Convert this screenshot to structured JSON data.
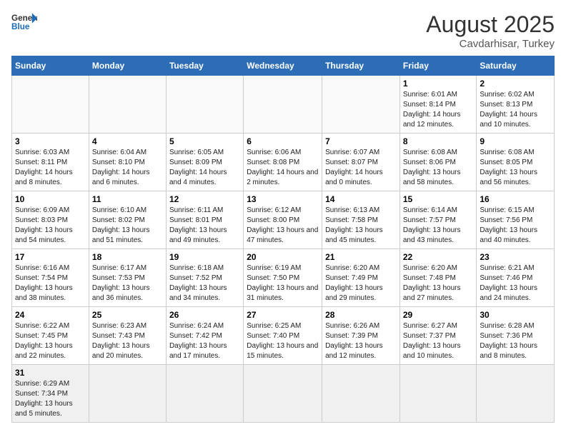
{
  "header": {
    "logo_general": "General",
    "logo_blue": "Blue",
    "month_year": "August 2025",
    "location": "Cavdarhisar, Turkey"
  },
  "days_of_week": [
    "Sunday",
    "Monday",
    "Tuesday",
    "Wednesday",
    "Thursday",
    "Friday",
    "Saturday"
  ],
  "weeks": [
    [
      {
        "day": "",
        "info": ""
      },
      {
        "day": "",
        "info": ""
      },
      {
        "day": "",
        "info": ""
      },
      {
        "day": "",
        "info": ""
      },
      {
        "day": "",
        "info": ""
      },
      {
        "day": "1",
        "info": "Sunrise: 6:01 AM\nSunset: 8:14 PM\nDaylight: 14 hours and 12 minutes."
      },
      {
        "day": "2",
        "info": "Sunrise: 6:02 AM\nSunset: 8:13 PM\nDaylight: 14 hours and 10 minutes."
      }
    ],
    [
      {
        "day": "3",
        "info": "Sunrise: 6:03 AM\nSunset: 8:11 PM\nDaylight: 14 hours and 8 minutes."
      },
      {
        "day": "4",
        "info": "Sunrise: 6:04 AM\nSunset: 8:10 PM\nDaylight: 14 hours and 6 minutes."
      },
      {
        "day": "5",
        "info": "Sunrise: 6:05 AM\nSunset: 8:09 PM\nDaylight: 14 hours and 4 minutes."
      },
      {
        "day": "6",
        "info": "Sunrise: 6:06 AM\nSunset: 8:08 PM\nDaylight: 14 hours and 2 minutes."
      },
      {
        "day": "7",
        "info": "Sunrise: 6:07 AM\nSunset: 8:07 PM\nDaylight: 14 hours and 0 minutes."
      },
      {
        "day": "8",
        "info": "Sunrise: 6:08 AM\nSunset: 8:06 PM\nDaylight: 13 hours and 58 minutes."
      },
      {
        "day": "9",
        "info": "Sunrise: 6:08 AM\nSunset: 8:05 PM\nDaylight: 13 hours and 56 minutes."
      }
    ],
    [
      {
        "day": "10",
        "info": "Sunrise: 6:09 AM\nSunset: 8:03 PM\nDaylight: 13 hours and 54 minutes."
      },
      {
        "day": "11",
        "info": "Sunrise: 6:10 AM\nSunset: 8:02 PM\nDaylight: 13 hours and 51 minutes."
      },
      {
        "day": "12",
        "info": "Sunrise: 6:11 AM\nSunset: 8:01 PM\nDaylight: 13 hours and 49 minutes."
      },
      {
        "day": "13",
        "info": "Sunrise: 6:12 AM\nSunset: 8:00 PM\nDaylight: 13 hours and 47 minutes."
      },
      {
        "day": "14",
        "info": "Sunrise: 6:13 AM\nSunset: 7:58 PM\nDaylight: 13 hours and 45 minutes."
      },
      {
        "day": "15",
        "info": "Sunrise: 6:14 AM\nSunset: 7:57 PM\nDaylight: 13 hours and 43 minutes."
      },
      {
        "day": "16",
        "info": "Sunrise: 6:15 AM\nSunset: 7:56 PM\nDaylight: 13 hours and 40 minutes."
      }
    ],
    [
      {
        "day": "17",
        "info": "Sunrise: 6:16 AM\nSunset: 7:54 PM\nDaylight: 13 hours and 38 minutes."
      },
      {
        "day": "18",
        "info": "Sunrise: 6:17 AM\nSunset: 7:53 PM\nDaylight: 13 hours and 36 minutes."
      },
      {
        "day": "19",
        "info": "Sunrise: 6:18 AM\nSunset: 7:52 PM\nDaylight: 13 hours and 34 minutes."
      },
      {
        "day": "20",
        "info": "Sunrise: 6:19 AM\nSunset: 7:50 PM\nDaylight: 13 hours and 31 minutes."
      },
      {
        "day": "21",
        "info": "Sunrise: 6:20 AM\nSunset: 7:49 PM\nDaylight: 13 hours and 29 minutes."
      },
      {
        "day": "22",
        "info": "Sunrise: 6:20 AM\nSunset: 7:48 PM\nDaylight: 13 hours and 27 minutes."
      },
      {
        "day": "23",
        "info": "Sunrise: 6:21 AM\nSunset: 7:46 PM\nDaylight: 13 hours and 24 minutes."
      }
    ],
    [
      {
        "day": "24",
        "info": "Sunrise: 6:22 AM\nSunset: 7:45 PM\nDaylight: 13 hours and 22 minutes."
      },
      {
        "day": "25",
        "info": "Sunrise: 6:23 AM\nSunset: 7:43 PM\nDaylight: 13 hours and 20 minutes."
      },
      {
        "day": "26",
        "info": "Sunrise: 6:24 AM\nSunset: 7:42 PM\nDaylight: 13 hours and 17 minutes."
      },
      {
        "day": "27",
        "info": "Sunrise: 6:25 AM\nSunset: 7:40 PM\nDaylight: 13 hours and 15 minutes."
      },
      {
        "day": "28",
        "info": "Sunrise: 6:26 AM\nSunset: 7:39 PM\nDaylight: 13 hours and 12 minutes."
      },
      {
        "day": "29",
        "info": "Sunrise: 6:27 AM\nSunset: 7:37 PM\nDaylight: 13 hours and 10 minutes."
      },
      {
        "day": "30",
        "info": "Sunrise: 6:28 AM\nSunset: 7:36 PM\nDaylight: 13 hours and 8 minutes."
      }
    ],
    [
      {
        "day": "31",
        "info": "Sunrise: 6:29 AM\nSunset: 7:34 PM\nDaylight: 13 hours and 5 minutes."
      },
      {
        "day": "",
        "info": ""
      },
      {
        "day": "",
        "info": ""
      },
      {
        "day": "",
        "info": ""
      },
      {
        "day": "",
        "info": ""
      },
      {
        "day": "",
        "info": ""
      },
      {
        "day": "",
        "info": ""
      }
    ]
  ]
}
